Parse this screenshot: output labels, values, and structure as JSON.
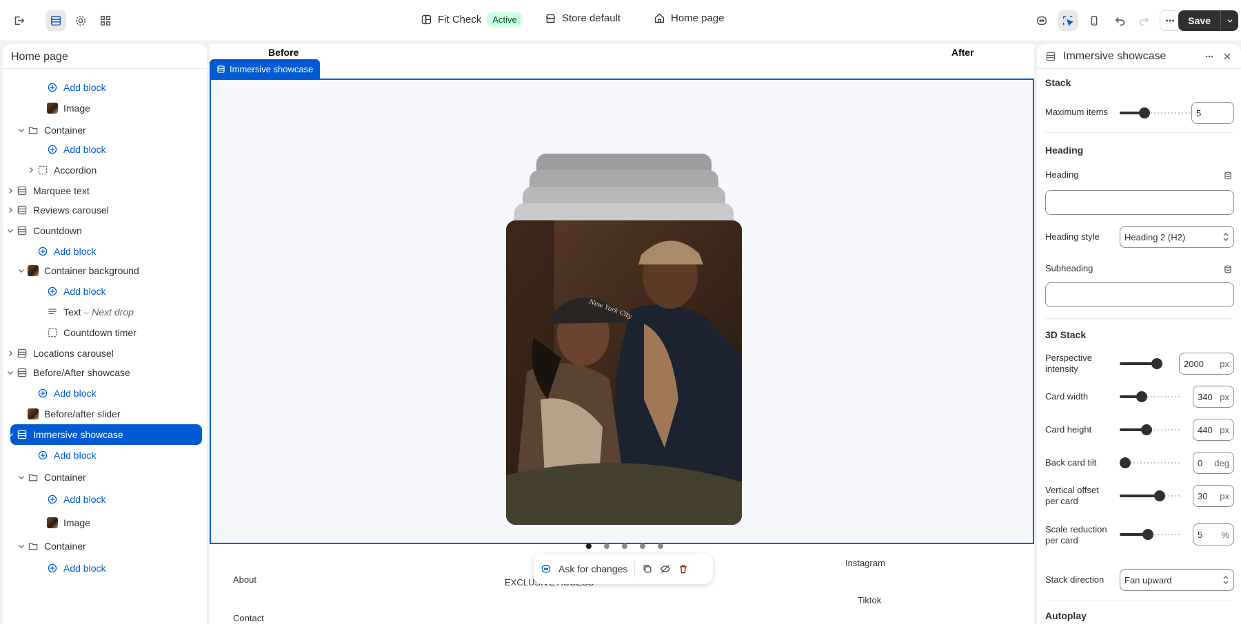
{
  "topbar": {
    "theme_name": "Fit Check",
    "theme_status": "Active",
    "store": "Store default",
    "page": "Home page",
    "save_label": "Save"
  },
  "left_panel": {
    "title": "Home page",
    "items": [
      {
        "label": "Add block",
        "kind": "add"
      },
      {
        "label": "Image",
        "kind": "thumb"
      },
      {
        "label": "Container",
        "kind": "folder"
      },
      {
        "label": "Add block",
        "kind": "add"
      },
      {
        "label": "Accordion",
        "kind": "block"
      },
      {
        "label": "Marquee text",
        "kind": "section"
      },
      {
        "label": "Reviews carousel",
        "kind": "section"
      },
      {
        "label": "Countdown",
        "kind": "section"
      },
      {
        "label": "Add block",
        "kind": "add"
      },
      {
        "label": "Container background",
        "kind": "thumb"
      },
      {
        "label": "Add block",
        "kind": "add"
      },
      {
        "label": "Text",
        "sub": "– Next drop",
        "kind": "text"
      },
      {
        "label": "Countdown timer",
        "kind": "block"
      },
      {
        "label": "Locations carousel",
        "kind": "section"
      },
      {
        "label": "Before/After showcase",
        "kind": "section"
      },
      {
        "label": "Add block",
        "kind": "add"
      },
      {
        "label": "Before/after slider",
        "kind": "thumb"
      },
      {
        "label": "Immersive showcase",
        "kind": "section-selected"
      },
      {
        "label": "Add block",
        "kind": "add"
      },
      {
        "label": "Container",
        "kind": "folder"
      },
      {
        "label": "Add block",
        "kind": "add"
      },
      {
        "label": "Image",
        "kind": "thumb"
      },
      {
        "label": "Container",
        "kind": "folder"
      },
      {
        "label": "Add block",
        "kind": "add"
      }
    ]
  },
  "canvas": {
    "before_label": "Before",
    "after_label": "After",
    "section_tag": "Immersive showcase",
    "photo_cap_text": "New York City",
    "slide_count": 5,
    "active_slide": 1,
    "footer": {
      "instagram": "Instagram",
      "about": "About",
      "exclusive": "EXCLUSIVE ACCESS",
      "tiktok": "Tiktok",
      "contact": "Contact"
    },
    "ask_label": "Ask for changes"
  },
  "right_panel": {
    "title": "Immersive showcase",
    "stack_heading": "Stack",
    "max_items_label": "Maximum items",
    "max_items_value": "5",
    "max_items_fraction": 0.33,
    "heading_section": "Heading",
    "heading_label": "Heading",
    "heading_style_label": "Heading style",
    "heading_style_value": "Heading 2 (H2)",
    "subheading_label": "Subheading",
    "stack3d_heading": "3D Stack",
    "perspective_label": "Perspective intensity",
    "perspective_value": "2000",
    "perspective_fraction": 1.0,
    "card_width_label": "Card width",
    "card_width_value": "340",
    "card_width_fraction": 0.32,
    "card_height_label": "Card height",
    "card_height_value": "440",
    "card_height_fraction": 0.42,
    "back_tilt_label": "Back card tilt",
    "back_tilt_value": "0",
    "back_tilt_fraction": 0.0,
    "vertical_offset_label": "Vertical offset per card",
    "vertical_offset_value": "30",
    "vertical_offset_fraction": 0.68,
    "scale_reduction_label": "Scale reduction per card",
    "scale_reduction_value": "5",
    "scale_reduction_fraction": 0.45,
    "stack_direction_label": "Stack direction",
    "stack_direction_value": "Fan upward",
    "autoplay_heading": "Autoplay",
    "units": {
      "px": "px",
      "deg": "deg",
      "pct": "%"
    }
  }
}
